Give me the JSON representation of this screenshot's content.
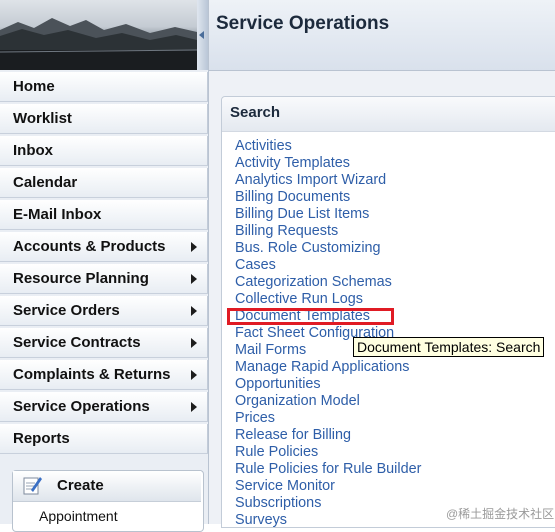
{
  "header": {
    "title": "Service Operations"
  },
  "nav": {
    "items": [
      {
        "label": "Home",
        "has_submenu": false
      },
      {
        "label": "Worklist",
        "has_submenu": false
      },
      {
        "label": "Inbox",
        "has_submenu": false
      },
      {
        "label": "Calendar",
        "has_submenu": false
      },
      {
        "label": "E-Mail Inbox",
        "has_submenu": false
      },
      {
        "label": "Accounts & Products",
        "has_submenu": true
      },
      {
        "label": "Resource Planning",
        "has_submenu": true
      },
      {
        "label": "Service Orders",
        "has_submenu": true
      },
      {
        "label": "Service Contracts",
        "has_submenu": true
      },
      {
        "label": "Complaints & Returns",
        "has_submenu": true
      },
      {
        "label": "Service Operations",
        "has_submenu": true
      },
      {
        "label": "Reports",
        "has_submenu": false
      }
    ]
  },
  "create": {
    "label": "Create",
    "icon": "pencil-icon",
    "items": [
      "Appointment"
    ]
  },
  "search": {
    "title": "Search",
    "links": [
      "Activities",
      "Activity Templates",
      "Analytics Import Wizard",
      "Billing Documents",
      "Billing Due List Items",
      "Billing Requests",
      "Bus. Role Customizing",
      "Cases",
      "Categorization Schemas",
      "Collective Run Logs",
      "Document Templates",
      "Fact Sheet Configuration",
      "Mail Forms",
      "Manage Rapid Applications",
      "Opportunities",
      "Organization Model",
      "Prices",
      "Release for Billing",
      "Rule Policies",
      "Rule Policies for Rule Builder",
      "Service Monitor",
      "Subscriptions",
      "Surveys"
    ],
    "highlighted": "Document Templates"
  },
  "tooltip": {
    "text": "Document Templates: Search"
  },
  "watermark": {
    "text": "@稀土掘金技术社区"
  },
  "colors": {
    "link": "#2e5ea8",
    "highlight_border": "#e01b24",
    "tooltip_bg": "#ffffe1"
  }
}
